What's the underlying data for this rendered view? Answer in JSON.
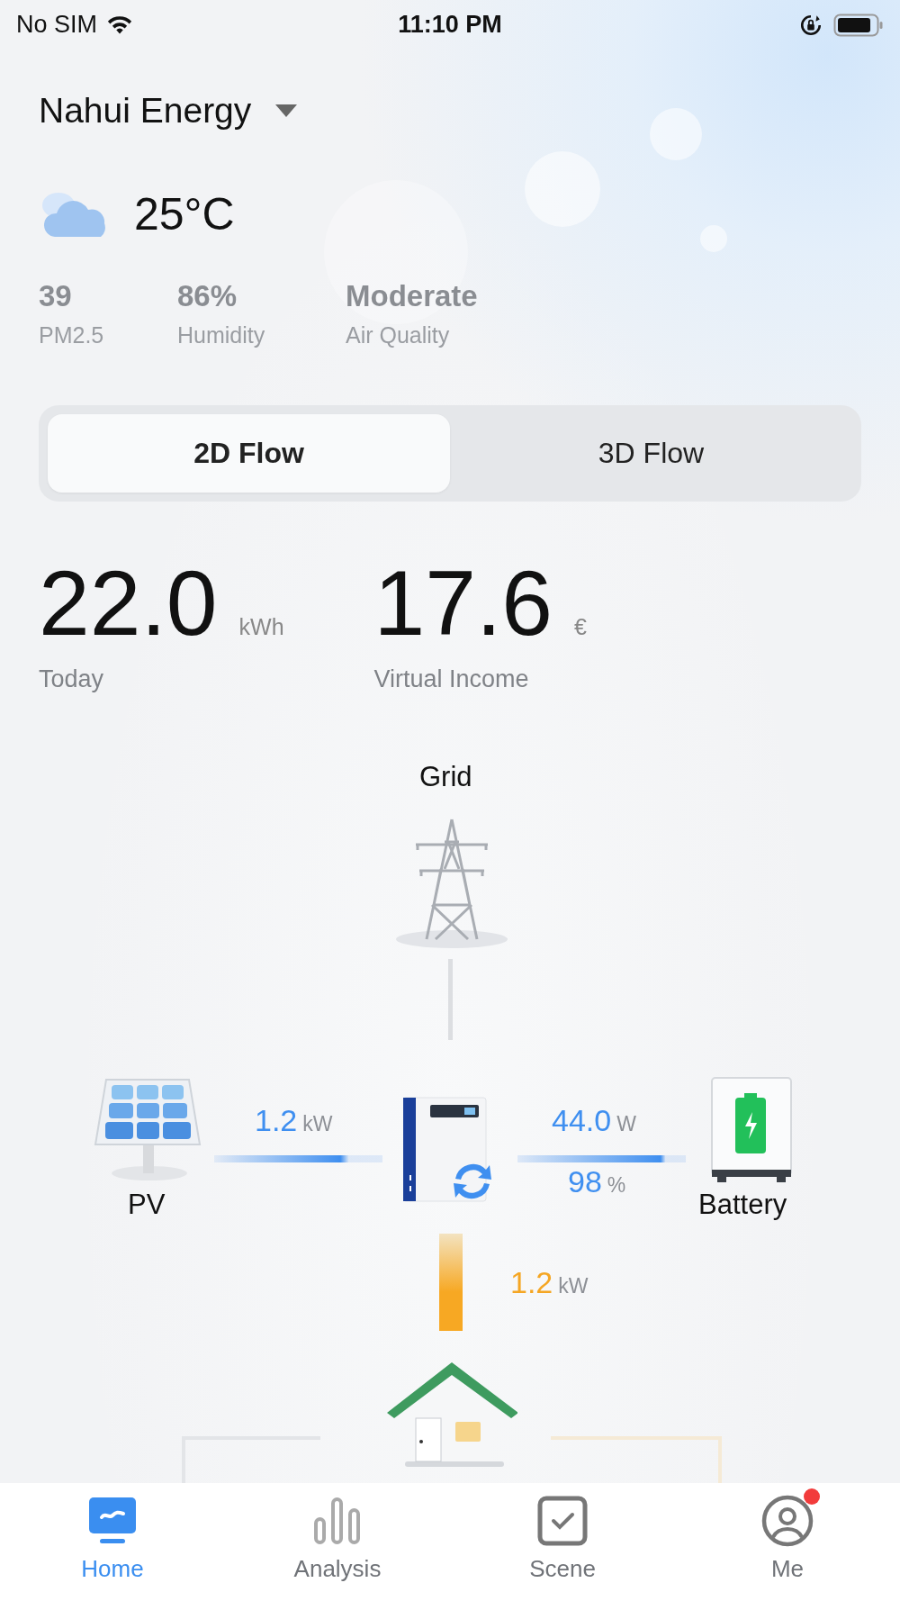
{
  "status_bar": {
    "carrier": "No SIM",
    "time": "11:10 PM"
  },
  "site": {
    "name": "Nahui Energy"
  },
  "weather": {
    "temperature": "25°C"
  },
  "stats": [
    {
      "value": "39",
      "label": "PM2.5"
    },
    {
      "value": "86%",
      "label": "Humidity"
    },
    {
      "value": "Moderate",
      "label": "Air Quality"
    }
  ],
  "view_tabs": [
    {
      "label": "2D Flow",
      "selected": true
    },
    {
      "label": "3D Flow",
      "selected": false
    }
  ],
  "summary": [
    {
      "value": "22.0",
      "unit": "kWh",
      "label": "Today"
    },
    {
      "value": "17.6",
      "unit": "€",
      "label": "Virtual Income"
    }
  ],
  "flow": {
    "grid": {
      "label": "Grid"
    },
    "pv": {
      "label": "PV",
      "value": "1.2",
      "unit": "kW"
    },
    "battery": {
      "label": "Battery",
      "value": "44.0",
      "unit": "W",
      "soc": "98",
      "soc_unit": "%"
    },
    "load": {
      "value": "1.2",
      "unit": "kW"
    }
  },
  "tabs": [
    {
      "kind": "home",
      "label": "Home",
      "selected": true,
      "badge": false
    },
    {
      "kind": "analysis",
      "label": "Analysis",
      "selected": false,
      "badge": false
    },
    {
      "kind": "scene",
      "label": "Scene",
      "selected": false,
      "badge": false
    },
    {
      "kind": "me",
      "label": "Me",
      "selected": false,
      "badge": true
    }
  ]
}
